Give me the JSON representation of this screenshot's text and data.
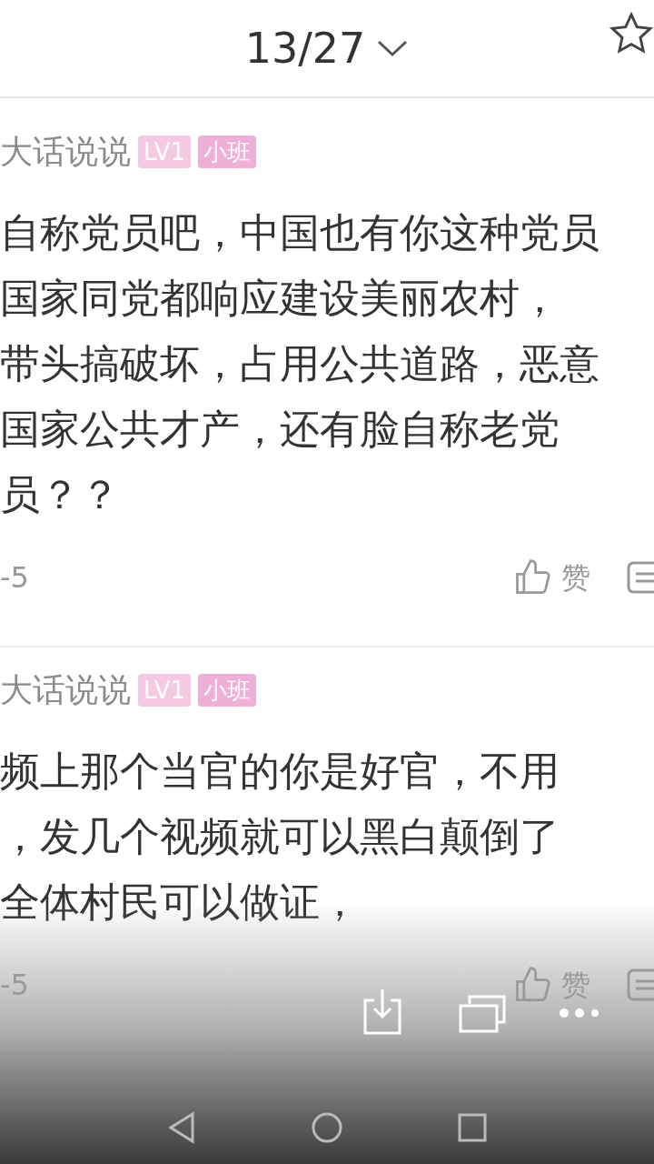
{
  "header": {
    "title": "13/27"
  },
  "comments": [
    {
      "username": "大话说说",
      "badges": [
        {
          "text": "LV1",
          "color": "#f6c9e2"
        },
        {
          "text": "小班",
          "color": "#efb0d8"
        }
      ],
      "lines": [
        "自称党员吧，中国也有你这种党员",
        "国家同党都响应建设美丽农村，",
        "带头搞破坏，占用公共道路，恶意",
        "国家公共才产，还有脸自称老党",
        "员？？"
      ],
      "date": "-5",
      "like_label": "赞"
    },
    {
      "username": "大话说说",
      "badges": [
        {
          "text": "LV1",
          "color": "#f6c9e2"
        },
        {
          "text": "小班",
          "color": "#efb0d8"
        }
      ],
      "lines": [
        "频上那个当官的你是好官，不用",
        "，发几个视频就可以黑白颠倒了",
        "全体村民可以做证，"
      ],
      "date": "-5",
      "like_label": "赞"
    }
  ]
}
